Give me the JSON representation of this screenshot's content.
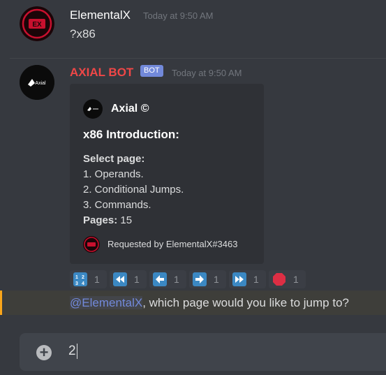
{
  "messages": [
    {
      "author": "ElementalX",
      "timestamp": "Today at 9:50 AM",
      "content": "?x86",
      "author_color": "#ffffff"
    },
    {
      "author": "AXIAL BOT",
      "badge": "BOT",
      "timestamp": "Today at 9:50 AM",
      "author_color": "#f04747",
      "embed": {
        "author_name": "Axial ©",
        "title": "x86 Introduction:",
        "field_label": "Select page:",
        "items": [
          "1. Operands.",
          "2. Conditional Jumps.",
          "3. Commands."
        ],
        "pages_label": "Pages:",
        "pages_value": "15",
        "footer": "Requested by ElementalX#3463"
      },
      "reactions": [
        {
          "icon": "numbers-1234-icon",
          "count": "1"
        },
        {
          "icon": "rewind-icon",
          "count": "1"
        },
        {
          "icon": "arrow-left-icon",
          "count": "1"
        },
        {
          "icon": "arrow-right-icon",
          "count": "1"
        },
        {
          "icon": "fast-forward-icon",
          "count": "1"
        },
        {
          "icon": "stop-sign-icon",
          "count": "1"
        }
      ]
    }
  ],
  "mention_line": {
    "mention": "@ElementalX",
    "text": ", which page would you like to jump to?"
  },
  "composer": {
    "value": "2"
  },
  "colors": {
    "accent_blue": "#3b88c3",
    "bot_red": "#f04747",
    "mention": "#7289da",
    "highlight_bar": "#faa61a"
  }
}
